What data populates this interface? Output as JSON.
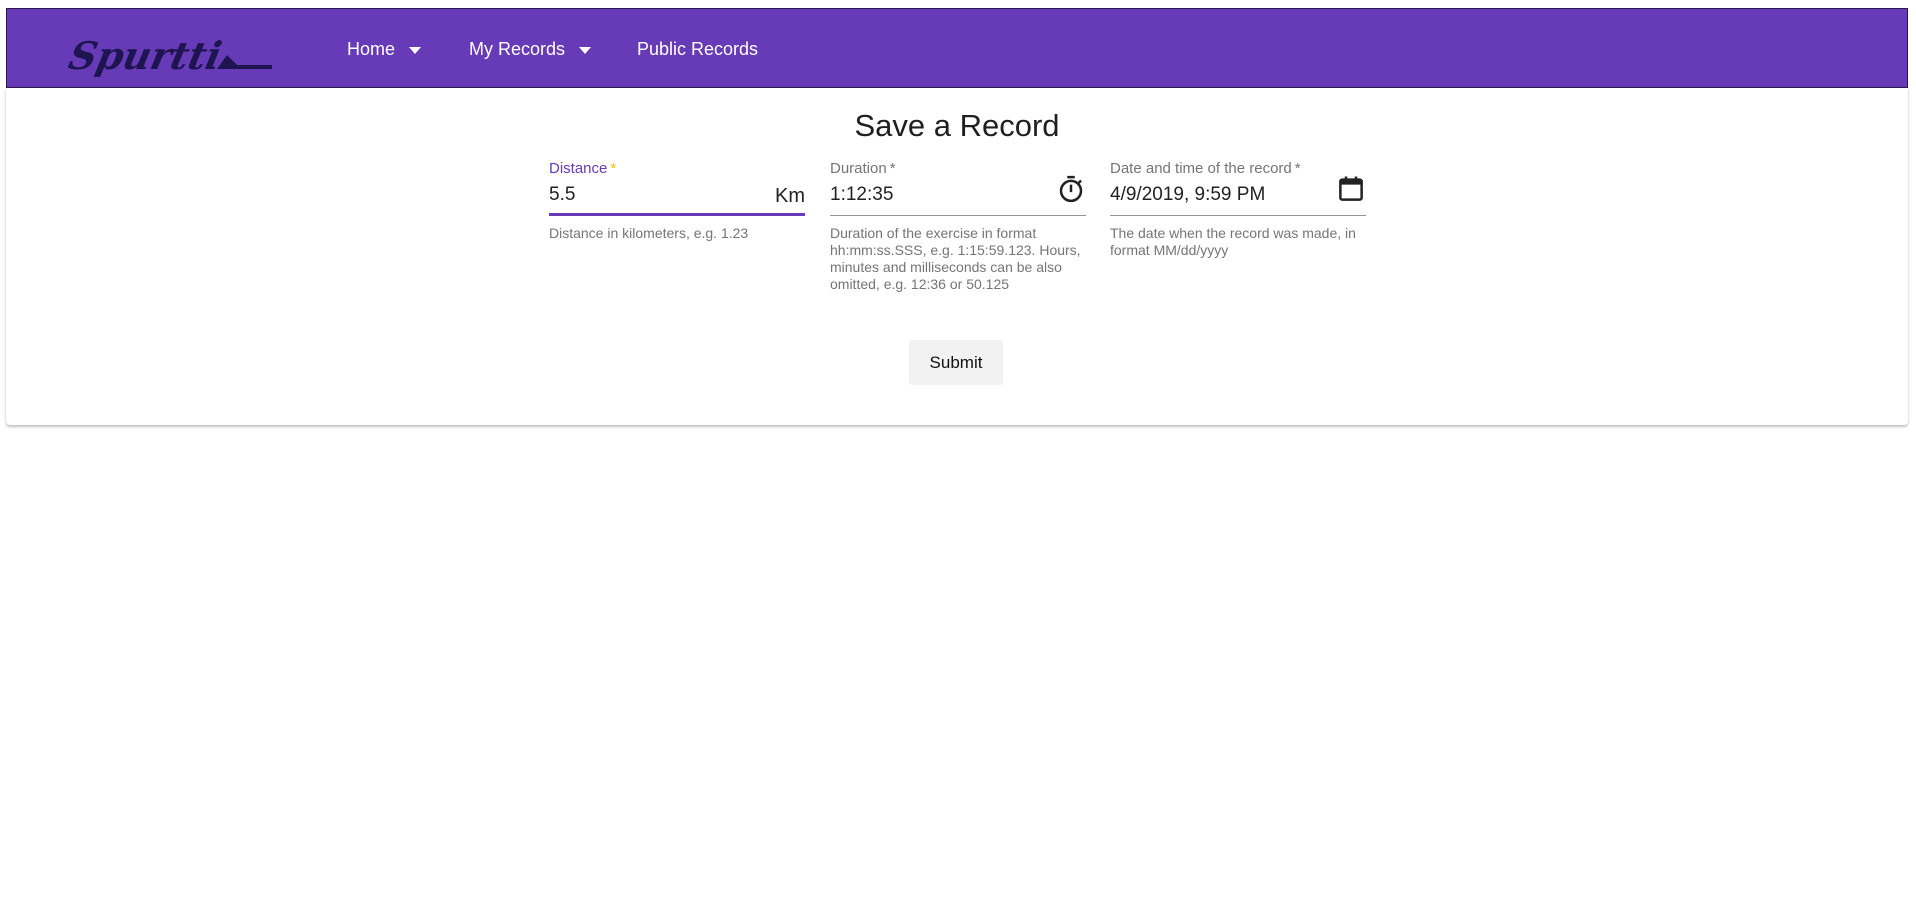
{
  "header": {
    "logo_text": "Spurtti",
    "nav": [
      {
        "label": "Home",
        "has_dropdown": true,
        "icon": "caret-down-icon"
      },
      {
        "label": "My Records",
        "has_dropdown": true,
        "icon": "caret-down-icon"
      },
      {
        "label": "Public Records",
        "has_dropdown": false
      }
    ],
    "colors": {
      "bar": "#673ab7",
      "logo": "#1e1450"
    }
  },
  "form": {
    "title": "Save a Record",
    "distance": {
      "label": "Distance",
      "required_mark": "*",
      "value": "5.5",
      "suffix": "Km",
      "hint": "Distance in kilometers, e.g. 1.23",
      "focused": true
    },
    "duration": {
      "label": "Duration",
      "required_mark": "*",
      "value": "1:12:35",
      "icon": "timer-icon",
      "hint": "Duration of the exercise in format hh:mm:ss.SSS, e.g. 1:15:59.123. Hours, minutes and milliseconds can be also omitted, e.g. 12:36 or 50.125"
    },
    "date": {
      "label": "Date and time of the record",
      "required_mark": "*",
      "value": "4/9/2019, 9:59 PM",
      "icon": "calendar-icon",
      "hint": "The date when the record was made, in format MM/dd/yyyy"
    },
    "submit_label": "Submit",
    "colors": {
      "accent": "#673ab7",
      "required_focused": "#ffc107"
    }
  }
}
